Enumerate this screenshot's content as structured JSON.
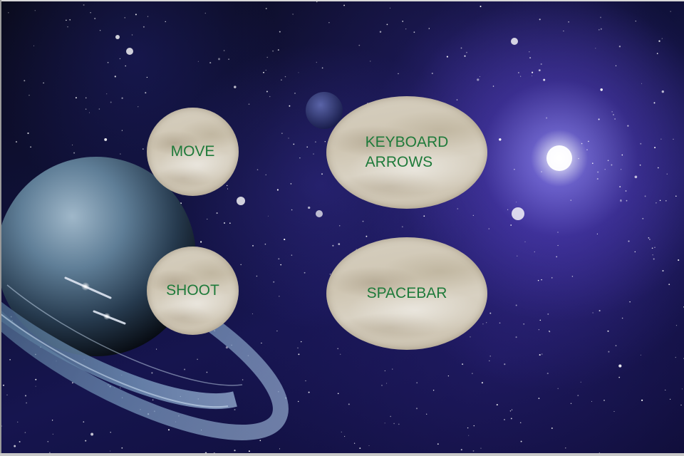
{
  "controls": {
    "move": {
      "action_label": "MOVE",
      "key_label": "KEYBOARD\nARROWS"
    },
    "shoot": {
      "action_label": "SHOOT",
      "key_label": "SPACEBAR"
    }
  },
  "colors": {
    "label_text": "#1e7a3a",
    "stone": "#d3cbb9",
    "space_background": "#10113a",
    "nebula_glow": "#8c7cff"
  },
  "icons": {
    "planet": "ringed-planet-icon",
    "moon": "small-moon-icon",
    "spaceships": "spaceship-icon"
  }
}
